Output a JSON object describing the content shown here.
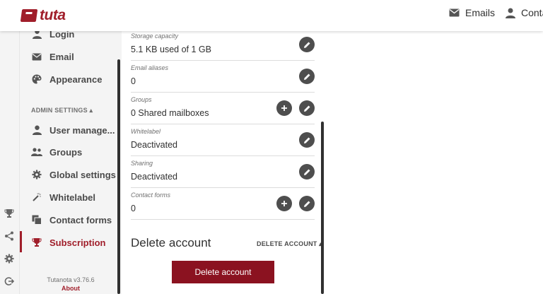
{
  "brand": {
    "name": "tuta",
    "color": "#a01e2a"
  },
  "topnav": {
    "emails": "Emails",
    "contacts": "Conta"
  },
  "nav": {
    "items": [
      {
        "label": "Login",
        "icon": "person-icon"
      },
      {
        "label": "Email",
        "icon": "mail-icon"
      },
      {
        "label": "Appearance",
        "icon": "palette-icon"
      }
    ],
    "admin_section": "ADMIN SETTINGS ▴",
    "admin_items": [
      {
        "label": "User manage...",
        "icon": "person-icon"
      },
      {
        "label": "Groups",
        "icon": "people-icon"
      },
      {
        "label": "Global settings",
        "icon": "gear-icon"
      },
      {
        "label": "Whitelabel",
        "icon": "magic-wand-icon"
      },
      {
        "label": "Contact forms",
        "icon": "contact-form-icon"
      },
      {
        "label": "Subscription",
        "icon": "trophy-icon",
        "active": true
      }
    ],
    "version": "Tutanota v3.76.6",
    "about": "About"
  },
  "fields": [
    {
      "label": "Storage capacity",
      "value": "5.1 KB used of 1 GB",
      "actions": [
        "edit"
      ]
    },
    {
      "label": "Email aliases",
      "value": "0",
      "actions": [
        "edit"
      ]
    },
    {
      "label": "Groups",
      "value": "0 Shared mailboxes",
      "actions": [
        "add",
        "edit"
      ]
    },
    {
      "label": "Whitelabel",
      "value": "Deactivated",
      "actions": [
        "edit"
      ]
    },
    {
      "label": "Sharing",
      "value": "Deactivated",
      "actions": [
        "edit"
      ]
    },
    {
      "label": "Contact forms",
      "value": "0",
      "actions": [
        "add",
        "edit"
      ]
    }
  ],
  "delete_section": {
    "title": "Delete account",
    "toggle": "DELETE ACCOUNT ▴",
    "button": "Delete account"
  }
}
